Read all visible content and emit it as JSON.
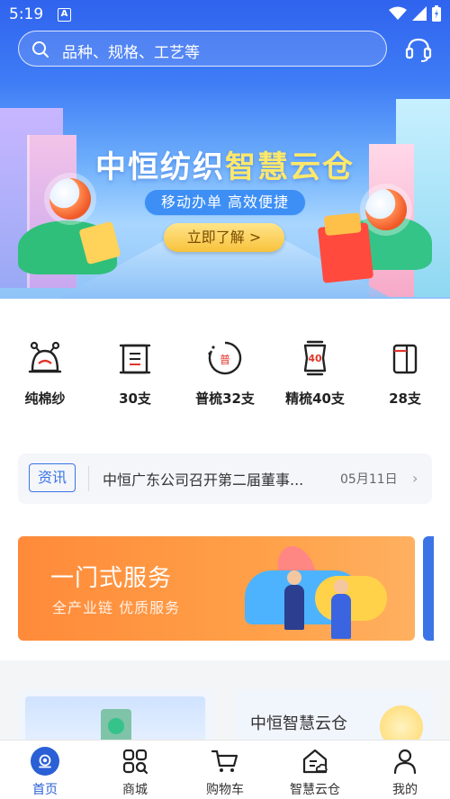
{
  "status_bar": {
    "time": "5:19"
  },
  "search": {
    "placeholder": "品种、规格、工艺等"
  },
  "banner": {
    "title_part1": "中恒纺织",
    "title_part2": "智慧云仓",
    "subtitle": "移动办单  高效便捷",
    "cta": "立即了解 >"
  },
  "categories": [
    {
      "label": "纯棉纱",
      "icon": "spool-icon"
    },
    {
      "label": "30支",
      "icon": "scroll-icon"
    },
    {
      "label": "普梳32支",
      "icon": "badge-icon",
      "badge": "普"
    },
    {
      "label": "精梳40支",
      "icon": "bobbin-icon",
      "badge": "40"
    },
    {
      "label": "28支",
      "icon": "cylinder-icon"
    }
  ],
  "news": {
    "tag": "资讯",
    "headline": "中恒广东公司召开第二届董事...",
    "date": "05月11日"
  },
  "promo": {
    "title": "一门式服务",
    "subtitle": "全产业链  优质服务"
  },
  "tiles": {
    "right_title": "中恒智慧云仓"
  },
  "bottom_nav": [
    {
      "label": "首页",
      "icon": "home-icon",
      "active": true
    },
    {
      "label": "商城",
      "icon": "mall-icon",
      "active": false
    },
    {
      "label": "购物车",
      "icon": "cart-icon",
      "active": false
    },
    {
      "label": "智慧云仓",
      "icon": "cloud-warehouse-icon",
      "active": false
    },
    {
      "label": "我的",
      "icon": "profile-icon",
      "active": false
    }
  ],
  "colors": {
    "primary": "#2a5fd6",
    "promo_orange": "#ff8a3a",
    "banner_highlight": "#ffe86a"
  }
}
